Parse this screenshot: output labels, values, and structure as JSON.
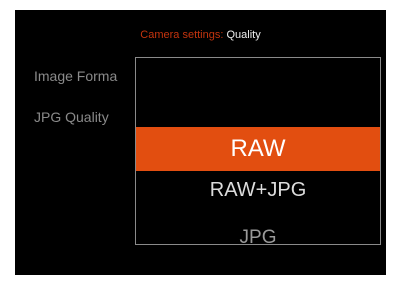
{
  "header": {
    "parent": "Camera settings:",
    "current": " Quality"
  },
  "settings": [
    {
      "label": "Image Forma"
    },
    {
      "label": "JPG Quality"
    }
  ],
  "dropdown": {
    "options": [
      {
        "label": "RAW",
        "selected": true
      },
      {
        "label": "RAW+JPG",
        "selected": false
      },
      {
        "label": "JPG",
        "selected": false
      }
    ]
  },
  "colors": {
    "accent": "#e24e10",
    "breadcrumb_parent": "#c4340e",
    "background": "#000000"
  }
}
